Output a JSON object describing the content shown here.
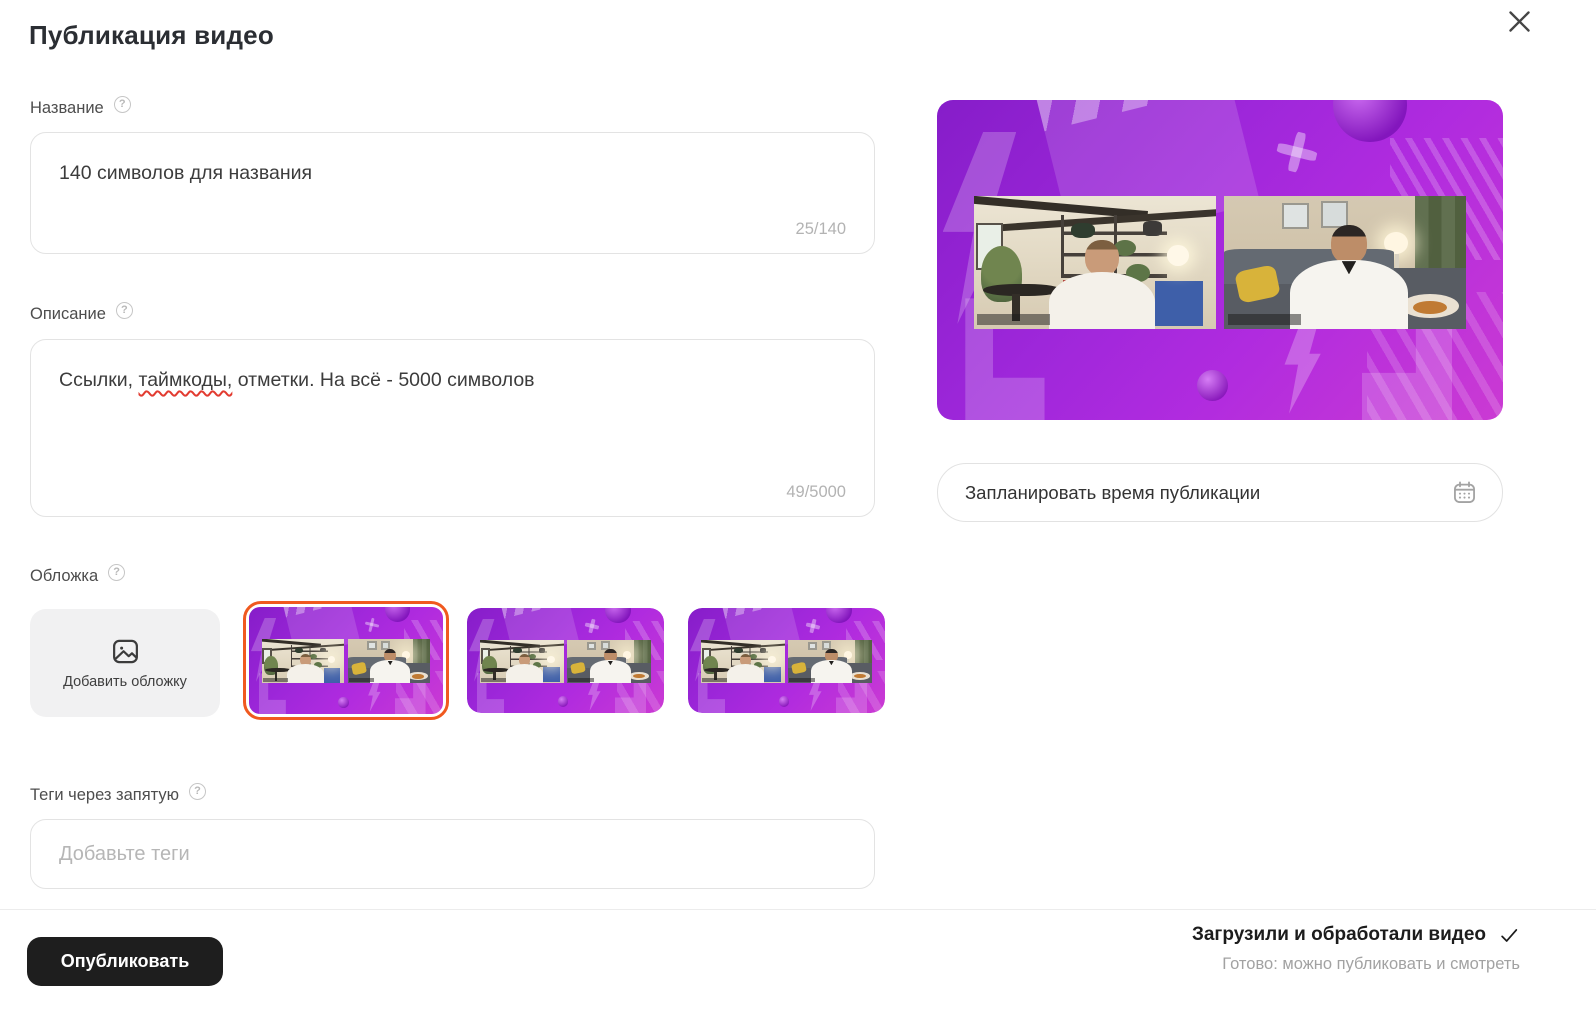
{
  "dialog": {
    "title": "Публикация видео"
  },
  "icons": {
    "close": "close-icon",
    "help_glyph": "?",
    "check": "check-icon",
    "calendar": "calendar-icon",
    "add_image": "image-icon"
  },
  "fields": {
    "title": {
      "label": "Название",
      "value": "140 символов для названия",
      "counter": "25/140"
    },
    "description": {
      "label": "Описание",
      "parts": [
        "Ссылки, ",
        "таймкоды,",
        " отметки. На всё - 5000 символов"
      ],
      "misspelled_part_index": 1,
      "counter": "49/5000"
    },
    "cover": {
      "label": "Обложка",
      "add_button_label": "Добавить обложку",
      "thumbnail_count": 3,
      "selected_thumbnail_index": 0
    },
    "tags": {
      "label": "Теги через запятую",
      "placeholder": "Добавьте теги"
    }
  },
  "schedule": {
    "label": "Запланировать время публикации"
  },
  "footer": {
    "publish_label": "Опубликовать",
    "status_title": "Загрузили и обработали видео",
    "status_subtitle": "Готово: можно публиковать и смотреть"
  },
  "colors": {
    "selected_thumb_border": "#F0591F",
    "publish_button": "#1E1E1E",
    "cover_purple_dark": "#861DC9",
    "cover_purple_light": "#CB3AD3",
    "spellcheck_red": "#E23B30",
    "input_border": "#E3E3E3"
  }
}
